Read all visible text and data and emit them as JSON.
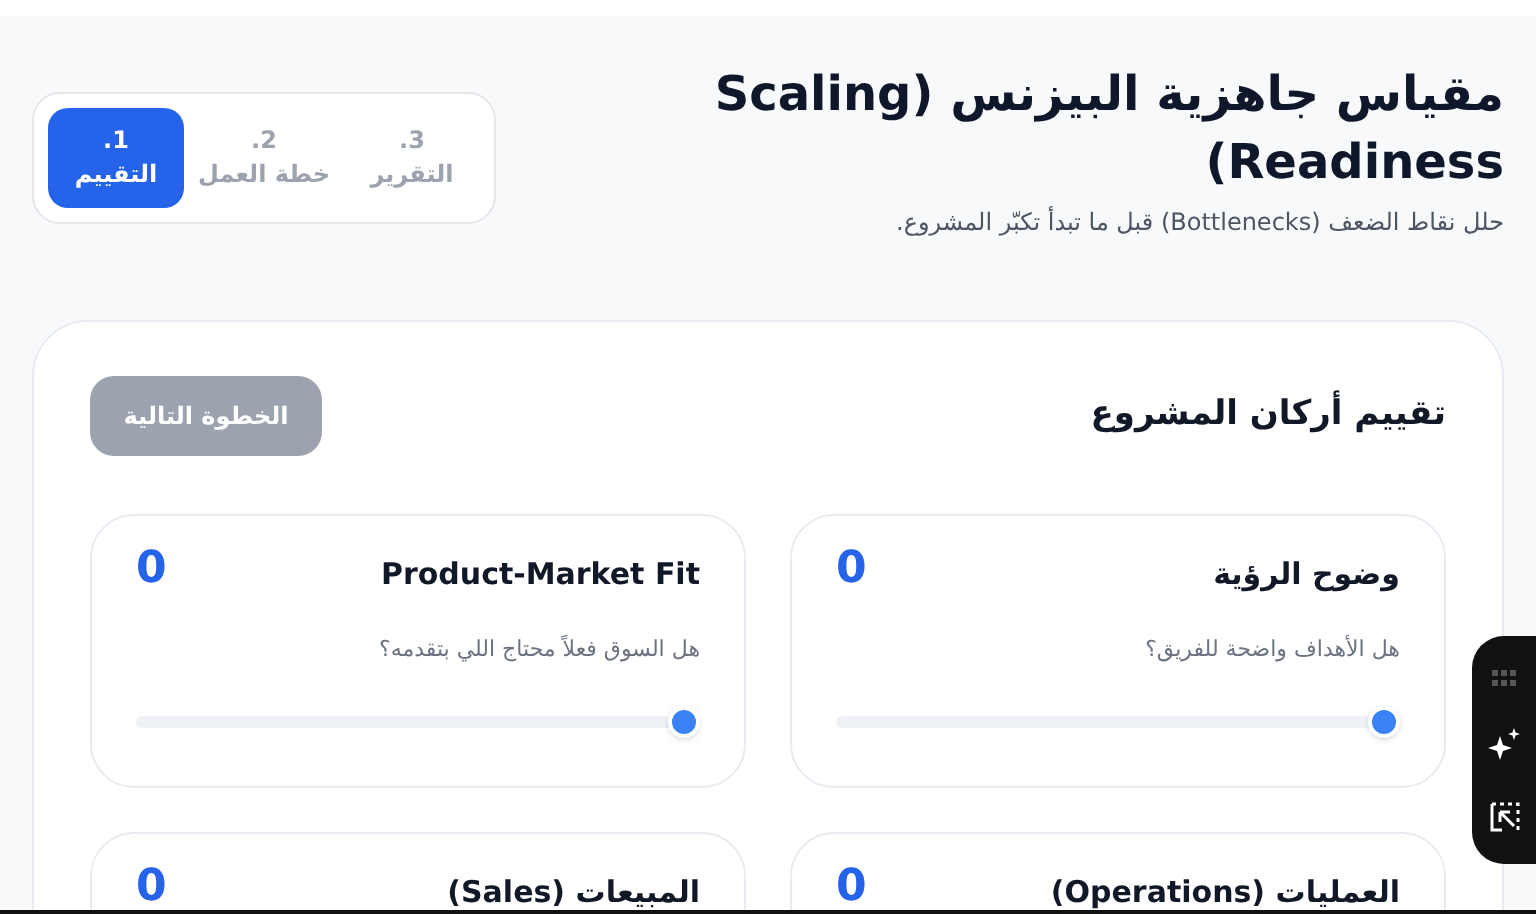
{
  "header": {
    "title": "مقياس جاهزية البيزنس (Scaling Readiness)",
    "subtitle": "حلل نقاط الضعف (Bottlenecks) قبل ما تبدأ تكبّر المشروع."
  },
  "steps": [
    {
      "number": "3.",
      "label": "التقرير",
      "selected": false
    },
    {
      "number": "2.",
      "label": "خطة العمل",
      "selected": false
    },
    {
      "number": "1.",
      "label": "التقييم",
      "selected": true
    }
  ],
  "panel": {
    "title": "تقييم أركان المشروع",
    "next_button": {
      "label": "الخطوة التالية",
      "disabled": true
    }
  },
  "pillars": [
    {
      "title": "وضوح الرؤية",
      "score": "0",
      "question": "هل الأهداف واضحة للفريق؟",
      "level": 0
    },
    {
      "title": "Product-Market Fit",
      "score": "0",
      "question": "هل السوق فعلاً محتاج اللي بتقدمه؟",
      "level": 0
    },
    {
      "title": "العمليات (Operations)",
      "score": "0"
    },
    {
      "title": "المبيعات (Sales)",
      "score": "0"
    }
  ]
}
